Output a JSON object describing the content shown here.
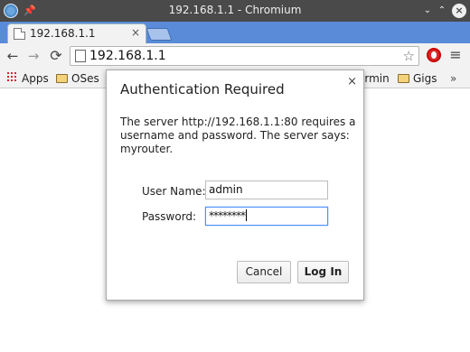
{
  "window": {
    "title": "192.168.1.1 - Chromium",
    "buttons": {
      "minimize": "⌄",
      "maximize": "⌃",
      "close": "×"
    }
  },
  "tabs": [
    {
      "label": "192.168.1.1",
      "close": "×"
    }
  ],
  "toolbar": {
    "back": "←",
    "forward": "→",
    "reload": "⟳",
    "url": "192.168.1.1",
    "star": "☆",
    "menu": "≡"
  },
  "bookmarks": {
    "apps": "Apps",
    "items": [
      "OSes",
      "armin",
      "Gigs"
    ],
    "more": "»"
  },
  "dialog": {
    "title": "Authentication Required",
    "close": "×",
    "message": "The server http://192.168.1.1:80 requires a username and password. The server says: myrouter.",
    "username_label": "User Name:",
    "username_value": "admin",
    "password_label": "Password:",
    "password_value": "********",
    "cancel_label": "Cancel",
    "login_label": "Log In"
  },
  "colors": {
    "titlebar": "#4a4a4a",
    "tabstrip": "#5a8bd9",
    "focus": "#4d90fe"
  }
}
